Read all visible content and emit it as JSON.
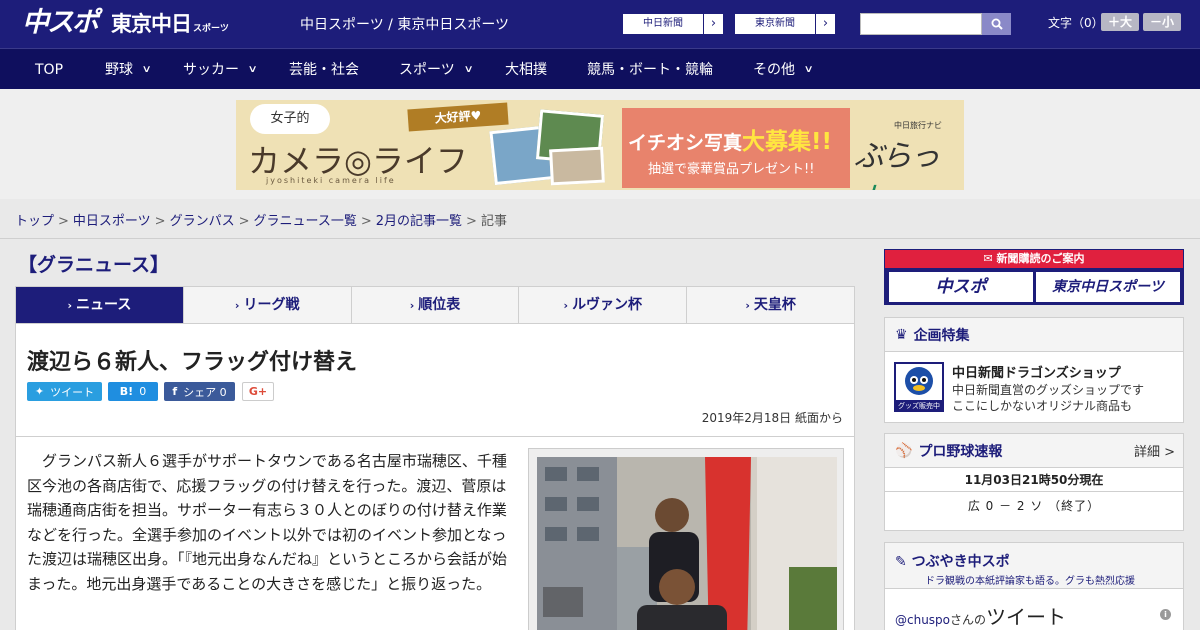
{
  "header": {
    "logo_main": "中スポ",
    "logo_sub": "東京中日",
    "logo_small": "スポーツ",
    "site_name": "中日スポーツ / 東京中日スポーツ",
    "ext_links": [
      {
        "label": "中日新聞"
      },
      {
        "label": "東京新聞"
      }
    ],
    "search_placeholder": "",
    "font_label": "文字（0）",
    "font_larger": "＋大",
    "font_smaller": "－小"
  },
  "nav": {
    "items": [
      {
        "label": "TOP"
      },
      {
        "label": "野球"
      },
      {
        "label": "サッカー"
      },
      {
        "label": "芸能・社会"
      },
      {
        "label": "スポーツ"
      },
      {
        "label": "大相撲"
      },
      {
        "label": "競馬・ボート・競輪"
      },
      {
        "label": "その他"
      }
    ]
  },
  "banner": {
    "bubble": "女子的",
    "ribbon": "大好評♥",
    "title": "カメラ◎ライフ",
    "subtitle": "jyoshiteki camera life",
    "headline_a": "イチオシ写真",
    "headline_b": "大募集!!",
    "headline_sub": "抽選で豪華賞品プレゼント!!",
    "brand_small": "中日旅行ナビ",
    "brand_a": "ぶらっ",
    "brand_b": "人"
  },
  "breadcrumb": {
    "items": [
      "トップ",
      "中日スポーツ",
      "グランパス",
      "グラニュース一覧",
      "2月の記事一覧"
    ],
    "current": "記事",
    "separator": ">"
  },
  "section": {
    "title": "【グラニュース】",
    "tabs": [
      {
        "label": "ニュース",
        "active": true
      },
      {
        "label": "リーグ戦"
      },
      {
        "label": "順位表"
      },
      {
        "label": "ルヴァン杯"
      },
      {
        "label": "天皇杯"
      }
    ]
  },
  "article": {
    "headline": "渡辺ら６新人、フラッグ付け替え",
    "share": {
      "tweet": "ツイート",
      "hatena_count": "0",
      "fb_label": "シェア 0"
    },
    "date": "2019年2月18日 紙面から",
    "body": "グランパス新人６選手がサポートタウンである名古屋市瑞穂区、千種区今池の各商店街で、応援フラッグの付け替えを行った。渡辺、菅原は瑞穂通商店街を担当。サポーター有志ら３０人とのぼりの付け替え作業などを行った。全選手参加のイベント以外では初のイベント参加となった渡辺は瑞穂区出身。「『地元出身なんだね』というところから会話が始まった。地元出身選手であることの大きさを感じた」と振り返った。"
  },
  "sidebar": {
    "subscribe": {
      "label": "新聞購読のご案内",
      "btn_a": "中スポ",
      "btn_b": "東京中日スポーツ"
    },
    "feature": {
      "title": "企画特集",
      "item_title": "中日新聞ドラゴンズショップ",
      "item_desc": [
        "中日新聞直営のグッズショップです",
        "ここにしかないオリジナル商品も"
      ],
      "img_label": "グッズ販売中"
    },
    "baseball": {
      "title": "プロ野球速報",
      "more": "詳細 >",
      "time": "11月03日21時50分現在",
      "score": "広 0 － 2 ソ （終了）"
    },
    "tweets": {
      "title": "つぶやき中スポ",
      "subtitle": "ドラ観戦の本紙評論家も語る。グラも熱烈応援",
      "handle": "@chuspo",
      "handle_suffix": "さんの",
      "heading": "ツイート"
    }
  },
  "colors": {
    "header": "#1d1d7a",
    "nav": "#0f0f5e",
    "accent_red": "#e0203e"
  }
}
